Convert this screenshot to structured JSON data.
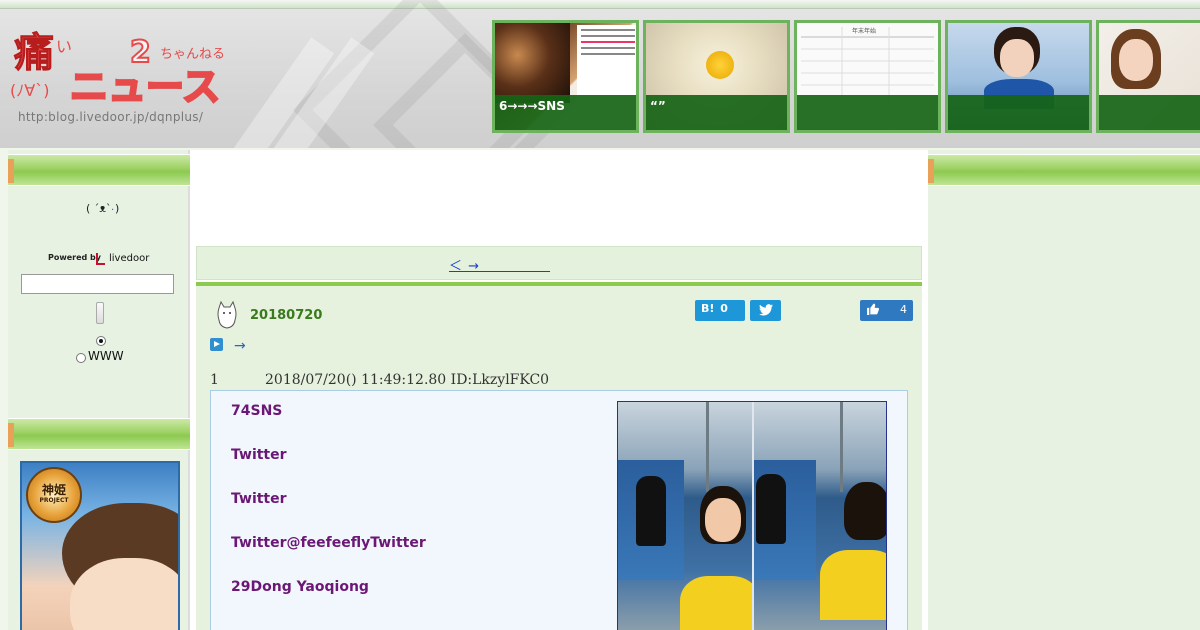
{
  "header": {
    "logo_text": "痛いニュース",
    "logo_sub": "ちゃんねる",
    "logo_face": "(ﾉ∀`)",
    "logo_url": "http:blog.livedoor.jp/dqnplus/",
    "thumbnails": [
      {
        "caption": "6→→→SNS"
      },
      {
        "caption": "“”"
      },
      {
        "caption": ""
      },
      {
        "caption": ""
      },
      {
        "caption": ""
      }
    ],
    "thumb2_chart_title": "年末年始",
    "colors": {
      "accent_green": "#6db25c",
      "caption_bg": "#166416"
    }
  },
  "sidebar": {
    "face_text": "( ´ᴥ` )",
    "face_link": ".",
    "powered_label": "Powered by",
    "livedoor_label": "livedoor",
    "search_placeholder": "",
    "radio_option": "WWW",
    "banner_emblem": "神姫",
    "banner_emblem_sub": "PROJECT"
  },
  "nav": {
    "links": "＜ →　　　　　"
  },
  "post": {
    "date": "20180720",
    "hatena_label": "B!",
    "hatena_count": "0",
    "like_count": "4",
    "arrow_link": "→",
    "res_number": "1",
    "res_meta": "2018/07/20() 11:49:12.80 ID:LkzylFKC0",
    "lines": [
      "74SNS",
      "Twitter",
      "Twitter",
      "Twitter@feefeeflyTwitter",
      "29Dong Yaoqiong"
    ]
  }
}
